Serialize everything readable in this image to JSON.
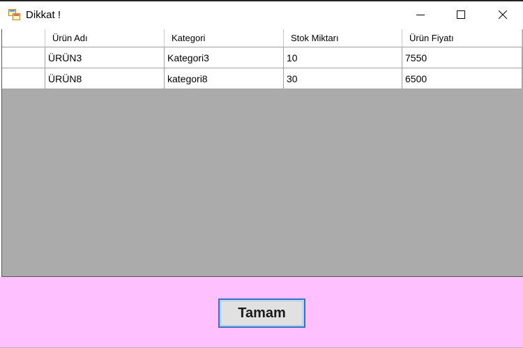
{
  "window": {
    "title": "Dikkat !"
  },
  "grid": {
    "columns": [
      "Ürün Adı",
      "Kategori",
      "Stok Miktarı",
      "Ürün Fiyatı"
    ],
    "rows": [
      [
        "ÜRÜN3",
        "Kategori3",
        "10",
        "7550"
      ],
      [
        "ÜRÜN8",
        "kategori8",
        "30",
        "6500"
      ]
    ]
  },
  "footer": {
    "ok_label": "Tamam",
    "background": "#ffc0ff"
  },
  "icons": {
    "app": "app-window-icon",
    "minimize": "minimize-icon",
    "maximize": "maximize-icon",
    "close": "close-icon"
  }
}
